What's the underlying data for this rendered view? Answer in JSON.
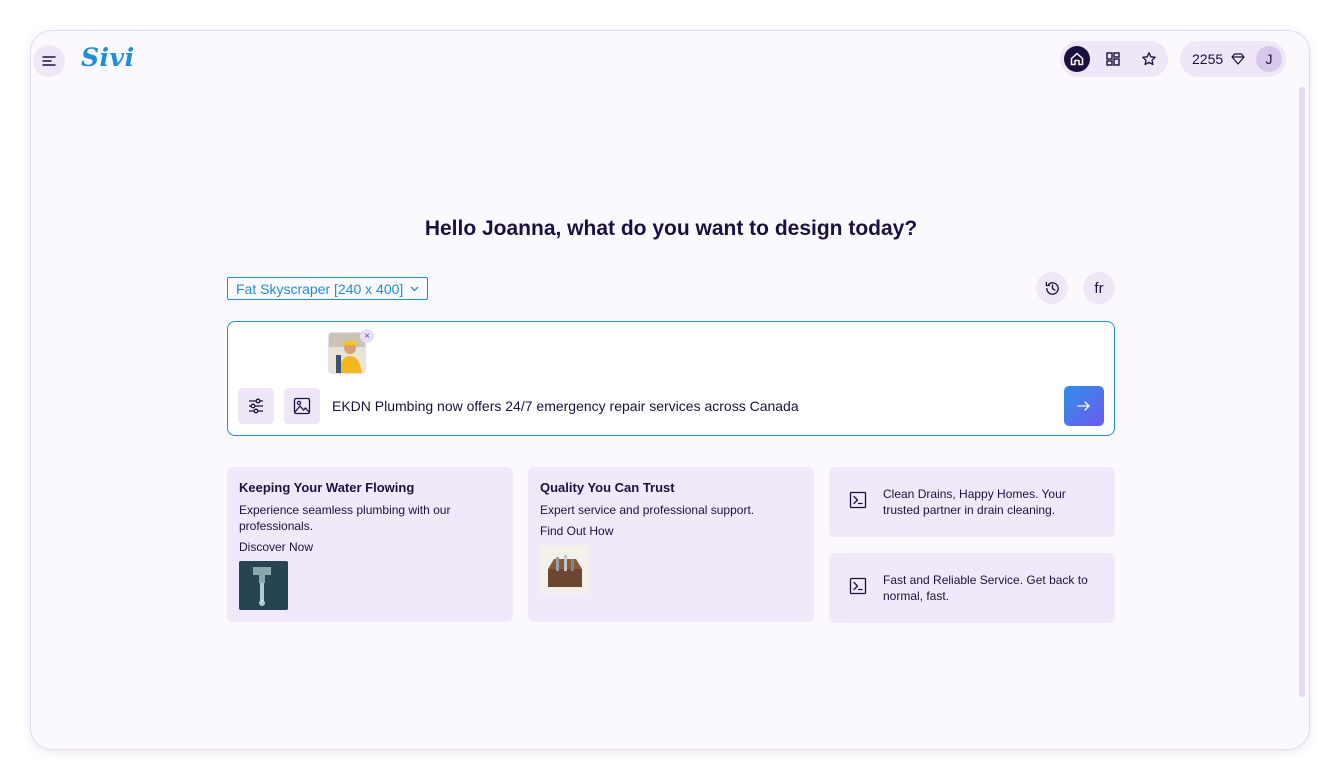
{
  "app": {
    "logo": "Sivi"
  },
  "header": {
    "nav": [
      {
        "icon": "home-icon",
        "active": true
      },
      {
        "icon": "grid-icon",
        "active": false
      },
      {
        "icon": "star-icon",
        "active": false
      }
    ],
    "credits": "2255",
    "credits_icon": "diamond-icon",
    "avatar_initial": "J"
  },
  "main": {
    "headline": "Hello Joanna, what do you want to design today?",
    "size_select": "Fat Skyscraper [240 x 400]",
    "language_label": "fr",
    "prompt": {
      "text": "EKDN Plumbing now offers 24/7 emergency repair services across Canada",
      "attachment_close": "×"
    }
  },
  "suggestions": [
    {
      "title": "Keeping Your Water Flowing",
      "description": "Experience seamless plumbing with our professionals.",
      "cta": "Discover Now"
    },
    {
      "title": "Quality You Can Trust",
      "description": "Expert service and professional support.",
      "cta": "Find Out How"
    },
    {
      "text": "Clean Drains, Happy Homes. Your trusted partner in drain cleaning."
    },
    {
      "text": "Fast and Reliable Service. Get back to normal, fast."
    }
  ],
  "colors": {
    "accent": "#1c8fd6",
    "dark": "#1b1140",
    "card_bg": "#f1e8fa",
    "background": "#fbf8fe"
  }
}
